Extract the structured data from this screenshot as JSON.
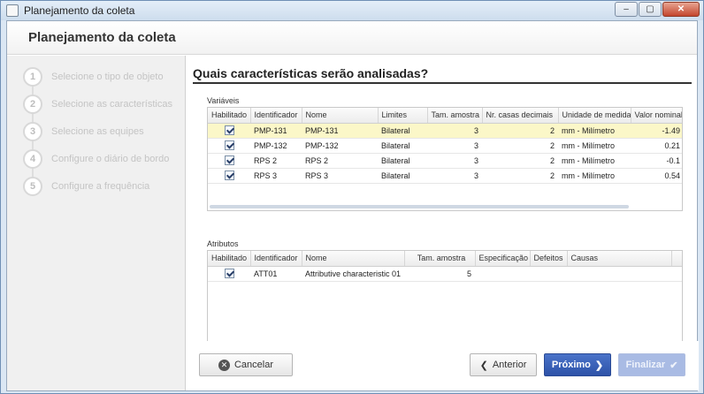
{
  "window": {
    "title": "Planejamento da coleta",
    "min": "‒",
    "max": "▢",
    "close": "✕"
  },
  "header": {
    "title": "Planejamento da coleta"
  },
  "steps": [
    {
      "num": "1",
      "label": "Selecione o tipo de objeto",
      "state": "done"
    },
    {
      "num": "2",
      "label": "Selecione as características",
      "state": "active"
    },
    {
      "num": "3",
      "label": "Selecione as equipes",
      "state": "pending"
    },
    {
      "num": "4",
      "label": "Configure o diário de bordo",
      "state": "pending"
    },
    {
      "num": "5",
      "label": "Configure a frequência",
      "state": "pending"
    }
  ],
  "main": {
    "title": "Quais características serão analisadas?"
  },
  "variables": {
    "label": "Variáveis",
    "columns": [
      "Habilitado",
      "Identificador",
      "Nome",
      "Limites",
      "Tam. amostra",
      "Nr. casas decimais",
      "Unidade de medida",
      "Valor nominal"
    ],
    "rows": [
      {
        "enabled": true,
        "id": "PMP-131",
        "name": "PMP-131",
        "limits": "Bilateral",
        "sample": "3",
        "decimals": "2",
        "unit": "mm - Milímetro",
        "nominal": "-1.49"
      },
      {
        "enabled": true,
        "id": "PMP-132",
        "name": "PMP-132",
        "limits": "Bilateral",
        "sample": "3",
        "decimals": "2",
        "unit": "mm - Milímetro",
        "nominal": "0.21"
      },
      {
        "enabled": true,
        "id": "RPS 2",
        "name": "RPS 2",
        "limits": "Bilateral",
        "sample": "3",
        "decimals": "2",
        "unit": "mm - Milímetro",
        "nominal": "-0.1"
      },
      {
        "enabled": true,
        "id": "RPS 3",
        "name": "RPS 3",
        "limits": "Bilateral",
        "sample": "3",
        "decimals": "2",
        "unit": "mm - Milímetro",
        "nominal": "0.54"
      }
    ]
  },
  "attributes": {
    "label": "Atributos",
    "columns": [
      "Habilitado",
      "Identificador",
      "Nome",
      "Tam. amostra",
      "Especificação",
      "Defeitos",
      "Causas"
    ],
    "rows": [
      {
        "enabled": true,
        "id": "ATT01",
        "name": "Attributive characteristic 01",
        "sample": "5",
        "spec": "",
        "defects": "",
        "causes": ""
      }
    ]
  },
  "footer": {
    "cancel": "Cancelar",
    "previous": "Anterior",
    "next": "Próximo",
    "finish": "Finalizar"
  }
}
